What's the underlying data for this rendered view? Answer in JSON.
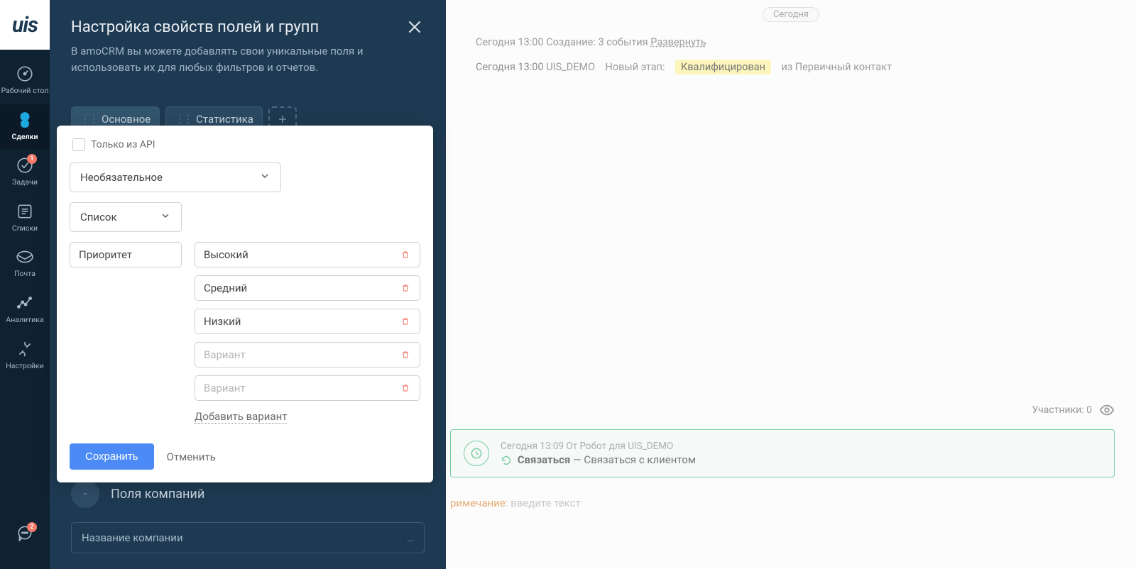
{
  "sidebar": {
    "logo": "uis",
    "items": [
      {
        "label": "Рабочий стол"
      },
      {
        "label": "Сделки"
      },
      {
        "label": "Задачи",
        "badge": "1"
      },
      {
        "label": "Списки"
      },
      {
        "label": "Почта"
      },
      {
        "label": "Аналитика"
      },
      {
        "label": "Настройки"
      }
    ],
    "chat_badge": "2"
  },
  "dark_panel": {
    "title": "Настройка свойств полей и групп",
    "subtitle": "В amoCRM вы можете добавлять свои уникальные поля и использовать их для любых фильтров и отчетов.",
    "tabs": [
      {
        "label": "Основное"
      },
      {
        "label": "Статистика"
      }
    ],
    "section_title": "Поля компаний",
    "company_placeholder": "Название компании"
  },
  "modal": {
    "api_only": "Только из API",
    "required_select": "Необязательное",
    "type_select": "Список",
    "name_value": "Приоритет",
    "options": [
      "Высокий",
      "Средний",
      "Низкий"
    ],
    "option_placeholder": "Вариант",
    "add_variant": "Добавить вариант",
    "save": "Сохранить",
    "cancel": "Отменить"
  },
  "right": {
    "today_label": "Сегодня",
    "row1_prefix": "Сегодня 13:00 Создание: 3 события",
    "row1_link": "Развернуть",
    "row2_time": "Сегодня 13:00",
    "row2_user": "UIS_DEMO",
    "row2_label": "Новый этап:",
    "row2_status": "Квалифицирован",
    "row2_from": "из Первичный контакт",
    "participants": "Участники: 0",
    "task_meta": "Сегодня 13:09 От Робот для UIS_DEMO",
    "task_action": "Связаться",
    "task_dash": " — Связаться с клиентом",
    "note_label": "римечание",
    "note_placeholder": ": введите текст"
  }
}
